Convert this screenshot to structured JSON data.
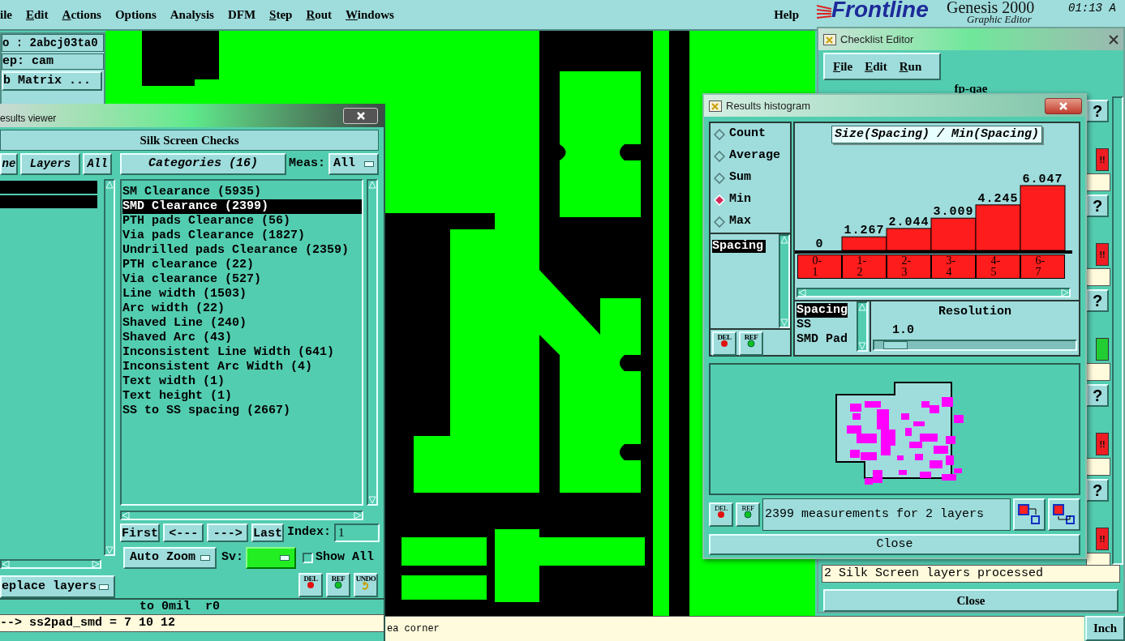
{
  "menu_bar": {
    "items": [
      {
        "label": "ile",
        "mnemonic": false
      },
      {
        "label": "Edit",
        "mnemonic": true
      },
      {
        "label": "Actions",
        "mnemonic": true
      },
      {
        "label": "Options",
        "mnemonic": false
      },
      {
        "label": "Analysis",
        "mnemonic": false
      },
      {
        "label": "DFM",
        "mnemonic": false
      },
      {
        "label": "Step",
        "mnemonic": true
      },
      {
        "label": "Rout",
        "mnemonic": true
      },
      {
        "label": "Windows",
        "mnemonic": true
      }
    ],
    "help": "Help"
  },
  "brand": {
    "logo": "Frontline",
    "product": "Genesis 2000",
    "subtitle": "Graphic Editor",
    "time": "01:13 A"
  },
  "job_panel": {
    "job": "o : 2abcj03ta0",
    "step": "ep: cam",
    "matrix_button": "b Matrix ..."
  },
  "results_viewer": {
    "title": "esults viewer",
    "heading": "Silk Screen Checks",
    "layer_tabs": [
      {
        "label": "ne"
      },
      {
        "label": "Layers"
      },
      {
        "label": "All"
      }
    ],
    "layer_rows": [
      {
        "selected": true
      },
      {
        "selected": true
      }
    ],
    "categories_button": "Categories (16)",
    "meas_label": "Meas:",
    "meas_value": "All",
    "categories": [
      {
        "label": "SM Clearance (5935)",
        "selected": false
      },
      {
        "label": "SMD Clearance (2399)",
        "selected": true
      },
      {
        "label": "PTH pads Clearance (56)",
        "selected": false
      },
      {
        "label": "Via pads Clearance (1827)",
        "selected": false
      },
      {
        "label": "Undrilled pads Clearance (2359)",
        "selected": false
      },
      {
        "label": "PTH clearance (22)",
        "selected": false
      },
      {
        "label": "Via clearance (527)",
        "selected": false
      },
      {
        "label": "Line width (1503)",
        "selected": false
      },
      {
        "label": "Arc width (22)",
        "selected": false
      },
      {
        "label": "Shaved Line (240)",
        "selected": false
      },
      {
        "label": "Shaved Arc (43)",
        "selected": false
      },
      {
        "label": "Inconsistent Line Width (641)",
        "selected": false
      },
      {
        "label": "Inconsistent Arc Width (4)",
        "selected": false
      },
      {
        "label": "Text width (1)",
        "selected": false
      },
      {
        "label": "Text height (1)",
        "selected": false
      },
      {
        "label": "SS to SS spacing (2667)",
        "selected": false
      }
    ],
    "nav_buttons": [
      "First",
      "<---",
      "--->",
      "Last"
    ],
    "index_label": "Index:",
    "index_value": "1",
    "zoom_mode": "Auto Zoom",
    "sv_label": "Sv:",
    "show_all": {
      "label": "Show All",
      "checked": false
    },
    "layer_mode": "eplace layers",
    "tools": [
      "DEL",
      "REF",
      "UNDO"
    ],
    "coords": "to 0mil  r0",
    "command": "--> ss2pad_smd = 7 10 12"
  },
  "histogram": {
    "title": "Results histogram",
    "modes": [
      {
        "label": "Count",
        "selected": false
      },
      {
        "label": "Average",
        "selected": false
      },
      {
        "label": "Sum",
        "selected": false
      },
      {
        "label": "Min",
        "selected": true
      },
      {
        "label": "Max",
        "selected": false
      }
    ],
    "measures": [
      {
        "label": "Spacing",
        "selected": true
      }
    ],
    "tools": [
      "DEL",
      "REF"
    ],
    "bottom_tools": [
      "DEL",
      "REF"
    ],
    "chart_data": {
      "type": "bar",
      "title": "Size(Spacing) / Min(Spacing)",
      "categories": [
        "0-1",
        "1-2",
        "2-3",
        "3-4",
        "4-5",
        "6-7"
      ],
      "values": [
        0,
        1.267,
        2.044,
        3.009,
        4.245,
        6.047
      ],
      "data_labels": true
    },
    "resolution_items": [
      {
        "label": "Spacing",
        "selected": true
      },
      {
        "label": "SS",
        "selected": false
      },
      {
        "label": "SMD Pad",
        "selected": false
      }
    ],
    "resolution_label": "Resolution",
    "resolution_value": "1.0",
    "resolution_slider": {
      "level": 0.05
    },
    "summary": "2399 measurements for 2 layers",
    "close": "Close"
  },
  "checklist_editor": {
    "title": "Checklist Editor",
    "menu": [
      "File",
      "Edit",
      "Run"
    ],
    "name": "fp-qae",
    "checks": [
      {
        "help": "?",
        "kind": "failed",
        "label": "!!",
        "color": "#ee1d23"
      },
      {
        "help": "?",
        "kind": "failed",
        "label": "!!",
        "color": "#ee1d23"
      },
      {
        "help": "?",
        "kind": "passed",
        "color": "#22cc33"
      },
      {
        "help": "?",
        "kind": "failed",
        "label": "!!",
        "color": "#ee1d23"
      },
      {
        "help": "?",
        "kind": "failed",
        "label": "!!",
        "color": "#ee1d23"
      }
    ],
    "message": "2 Silk Screen layers processed",
    "close": "Close"
  },
  "status_bar": {
    "message": "ea corner",
    "units": "Inch"
  }
}
